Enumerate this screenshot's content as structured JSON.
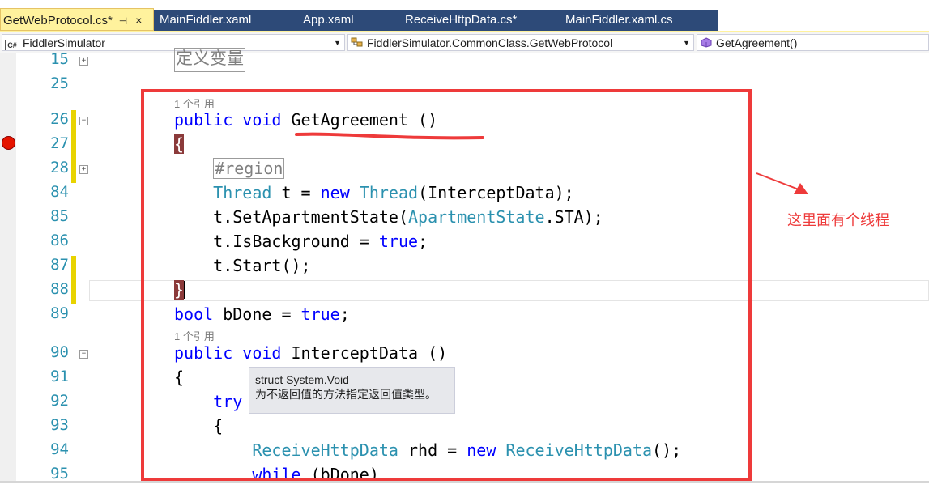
{
  "tabs": [
    {
      "label": "GetWebProtocol.cs*",
      "active": true,
      "pin": "⊣",
      "close": "×"
    },
    {
      "label": "MainFiddler.xaml"
    },
    {
      "label": "App.xaml"
    },
    {
      "label": "ReceiveHttpData.cs*"
    },
    {
      "label": "MainFiddler.xaml.cs"
    }
  ],
  "navbar": {
    "project_icon": "C#",
    "project": "FiddlerSimulator",
    "class": "FiddlerSimulator.CommonClass.GetWebProtocol",
    "member": "GetAgreement()"
  },
  "editor": {
    "region_label": "定义变量",
    "references_label": "1 个引用",
    "line_numbers": [
      "15",
      "25",
      "26",
      "27",
      "28",
      "84",
      "85",
      "86",
      "87",
      "88",
      "89",
      "90",
      "91",
      "92",
      "93",
      "94",
      "95"
    ]
  },
  "tooltip": {
    "line1": "struct System.Void",
    "line2": "为不返回值的方法指定返回值类型。"
  },
  "annotation": {
    "text": "这里面有个线程",
    "color": "#ee3a3a"
  },
  "colors": {
    "keyword": "#0000ff",
    "type": "#2b91af",
    "line_number": "#2b91af",
    "active_tab": "#fff29d",
    "tab_strip": "#2d4a78"
  }
}
